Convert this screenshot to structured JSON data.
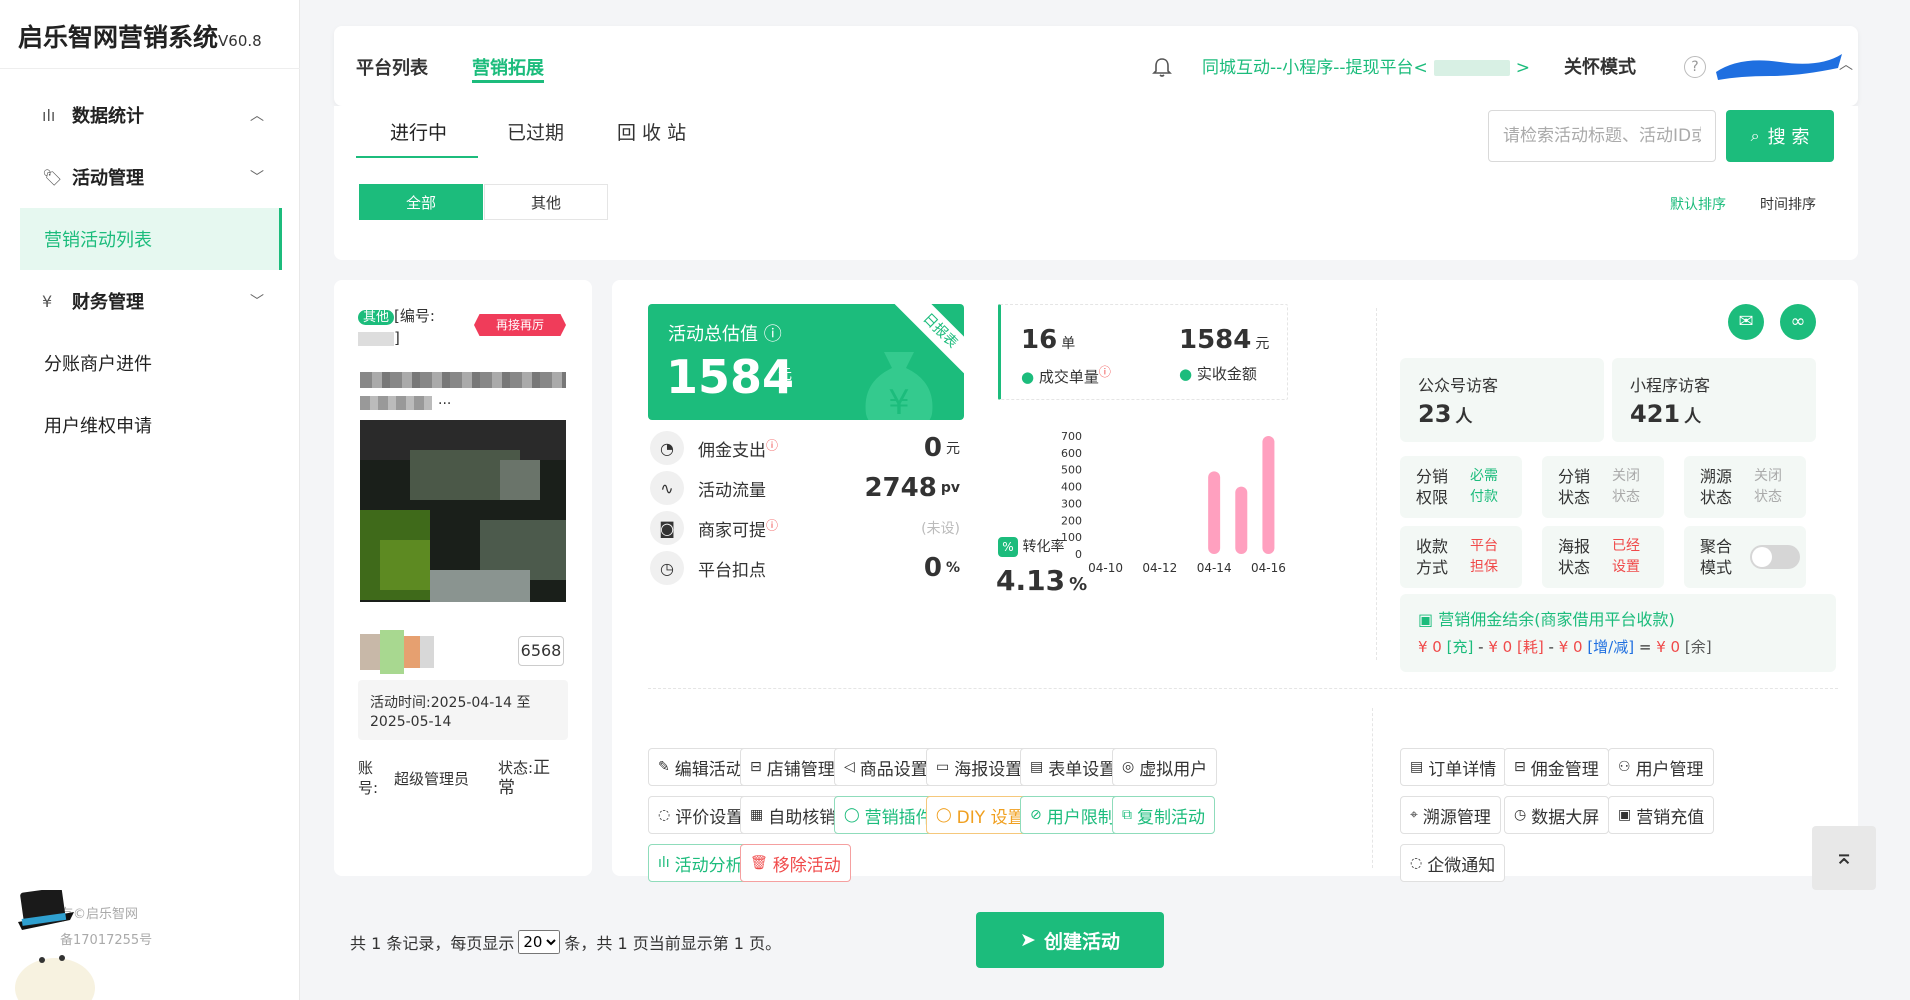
{
  "app": {
    "name": "启乐智网营销系统",
    "version": "V60.8"
  },
  "sidebar": {
    "items": [
      {
        "label": "数据统计"
      },
      {
        "label": "活动管理"
      },
      {
        "label": "营销活动列表"
      },
      {
        "label": "财务管理"
      },
      {
        "label": "分账商户进件"
      },
      {
        "label": "用户维权申请"
      }
    ],
    "footer": {
      "line1": "有©启乐智网",
      "line2": "备17017255号"
    }
  },
  "header": {
    "tabs": [
      "平台列表",
      "营销拓展"
    ],
    "platform_link": "同城互动--小程序--提现平台<",
    "platform_link_end": ">",
    "mode_button": "关怀模式",
    "help": "?"
  },
  "filters": {
    "status_tabs": [
      "进行中",
      "已过期",
      "回 收 站"
    ],
    "type_buttons": [
      "全部",
      "其他"
    ],
    "search_placeholder": "请检索活动标题、活动ID或",
    "search_button": "搜 索",
    "sort": [
      "默认排序",
      "时间排序"
    ]
  },
  "activity": {
    "tag": "其他",
    "id_label": "[编号:",
    "id_end": "]",
    "badge": "再接再厉",
    "title_tail": "...",
    "count": "6568",
    "time_label": "活动时间:2025-04-14 至 2025-05-14",
    "account_label": "账号:",
    "account_value": "超级管理员",
    "status_label": "状态:",
    "status_value": "正常"
  },
  "stats": {
    "total_label": "活动总估值",
    "total_value": "1584",
    "total_unit": "元",
    "daily_report": "日报表",
    "rows": [
      {
        "label": "佣金支出",
        "value": "0",
        "unit": "元"
      },
      {
        "label": "活动流量",
        "value": "2748",
        "unit": "pv"
      },
      {
        "label": "商家可提",
        "value": "",
        "unit": "",
        "note": "(未设)"
      },
      {
        "label": "平台扣点",
        "value": "0",
        "unit": "%"
      }
    ],
    "orders_value": "16",
    "orders_unit": "单",
    "orders_label": "成交单量",
    "amount_value": "1584",
    "amount_unit": "元",
    "amount_label": "实收金额",
    "conversion_label": "转化率",
    "conversion_value": "4.13",
    "conversion_unit": "%"
  },
  "chart_data": {
    "type": "bar",
    "categories": [
      "04-10",
      "04-11",
      "04-12",
      "04-13",
      "04-14",
      "04-15",
      "04-16"
    ],
    "x_tick_labels": [
      "04-10",
      "04-12",
      "04-14",
      "04-16"
    ],
    "values": [
      0,
      0,
      0,
      0,
      490,
      400,
      700
    ],
    "ylim": [
      0,
      700
    ],
    "yticks": [
      0,
      100,
      200,
      300,
      400,
      500,
      600,
      700
    ],
    "bar_color": "#ffa0bf",
    "grid": false
  },
  "visitors": {
    "official": {
      "label": "公众号访客",
      "value": "23",
      "unit": "人"
    },
    "mini": {
      "label": "小程序访客",
      "value": "421",
      "unit": "人"
    }
  },
  "settings": [
    {
      "label1": "分销",
      "label2": "权限",
      "val1": "必需",
      "val2": "付款",
      "color": "#1cbc7c"
    },
    {
      "label1": "分销",
      "label2": "状态",
      "val1": "关闭",
      "val2": "状态",
      "color": "#aaaaaa"
    },
    {
      "label1": "溯源",
      "label2": "状态",
      "val1": "关闭",
      "val2": "状态",
      "color": "#aaaaaa"
    },
    {
      "label1": "收款",
      "label2": "方式",
      "val1": "平台",
      "val2": "担保",
      "color": "#f04a4a"
    },
    {
      "label1": "海报",
      "label2": "状态",
      "val1": "已经",
      "val2": "设置",
      "color": "#f04a4a"
    },
    {
      "label1": "聚合",
      "label2": "模式"
    }
  ],
  "settlement": {
    "title": "营销佣金结余(商家借用平台收款)",
    "p1": "¥ 0",
    "t1": "[充]",
    "p2": "¥ 0",
    "t2": "[耗]",
    "p3": "¥ 0",
    "t3": "[增/减]",
    "p4": "¥ 0",
    "t4": "[余]",
    "minus": "-",
    "equals": "="
  },
  "actions": {
    "left": [
      "编辑活动",
      "店铺管理",
      "商品设置",
      "海报设置",
      "表单设置",
      "虚拟用户",
      "评价设置",
      "自助核销",
      "营销插件",
      "DIY 设置",
      "用户限制",
      "复制活动",
      "活动分析",
      "移除活动"
    ],
    "right": [
      "订单详情",
      "佣金管理",
      "用户管理",
      "溯源管理",
      "数据大屏",
      "营销充值",
      "企微通知"
    ]
  },
  "pagination": {
    "text1": "共 1 条记录，每页显示",
    "page_size": "20",
    "text2": "条，共 1 页当前显示第 1 页。",
    "create_button": "创建活动"
  },
  "colors": {
    "accent": "#1cbc7c",
    "danger": "#f04a4a",
    "warning": "#f0a020",
    "chart_bar": "#ffa0bf"
  }
}
